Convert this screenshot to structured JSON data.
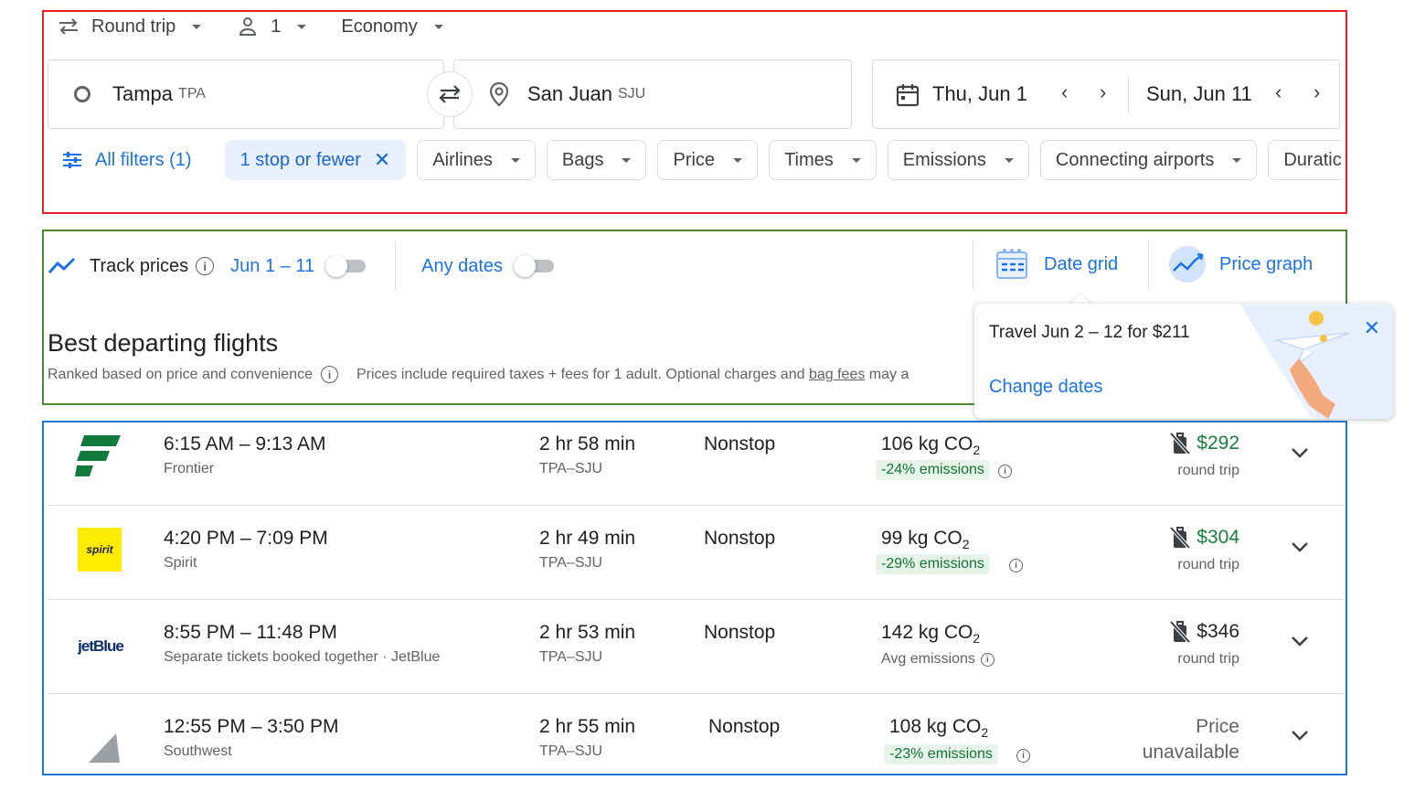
{
  "search": {
    "trip_type": "Round trip",
    "passengers": "1",
    "cabin": "Economy",
    "origin_city": "Tampa",
    "origin_code": "TPA",
    "dest_city": "San Juan",
    "dest_code": "SJU",
    "depart_date": "Thu, Jun 1",
    "return_date": "Sun, Jun 11"
  },
  "filters": {
    "all_filters": "All filters (1)",
    "chips": [
      "1 stop or fewer",
      "Airlines",
      "Bags",
      "Price",
      "Times",
      "Emissions",
      "Connecting airports",
      "Duratic"
    ]
  },
  "tracking": {
    "label": "Track prices",
    "range": "Jun 1 – 11",
    "any_dates": "Any dates",
    "date_grid": "Date grid",
    "price_graph": "Price graph"
  },
  "results": {
    "title": "Best departing flights",
    "ranked_note": "Ranked based on price and convenience",
    "price_note": "Prices include required taxes + fees for 1 adult. Optional charges and",
    "bag_fees": "bag fees",
    "price_note_tail": "may a"
  },
  "popover": {
    "text": "Travel Jun 2 – 12 for $211",
    "link": "Change dates"
  },
  "flights": [
    {
      "times": "6:15 AM – 9:13 AM",
      "airline": "Frontier",
      "duration": "2 hr 58 min",
      "route": "TPA–SJU",
      "stops": "Nonstop",
      "co2": "106 kg CO",
      "emissions": "-24% emissions",
      "price": "$292",
      "price_sub": "round trip"
    },
    {
      "times": "4:20 PM – 7:09 PM",
      "airline": "Spirit",
      "duration": "2 hr 49 min",
      "route": "TPA–SJU",
      "stops": "Nonstop",
      "co2": "99 kg CO",
      "emissions": "-29% emissions",
      "price": "$304",
      "price_sub": "round trip",
      "logo_text": "spirit"
    },
    {
      "times": "8:55 PM – 11:48 PM",
      "airline": "Separate tickets booked together · JetBlue",
      "duration": "2 hr 53 min",
      "route": "TPA–SJU",
      "stops": "Nonstop",
      "co2": "142 kg CO",
      "emissions": "Avg emissions",
      "price": "$346",
      "price_sub": "round trip",
      "logo_text": "jetBlue"
    },
    {
      "times": "12:55 PM – 3:50 PM",
      "airline": "Southwest",
      "duration": "2 hr 55 min",
      "route": "TPA–SJU",
      "stops": "Nonstop",
      "co2": "108 kg CO",
      "emissions": "-23% emissions",
      "price_line1": "Price",
      "price_line2": "unavailable"
    }
  ],
  "co2_sub": "2",
  "colors": {
    "accent": "#1a73e8",
    "green": "#188038",
    "annot_red": "#e8202a",
    "annot_green": "#4a8a33",
    "annot_blue": "#1f78d1"
  }
}
